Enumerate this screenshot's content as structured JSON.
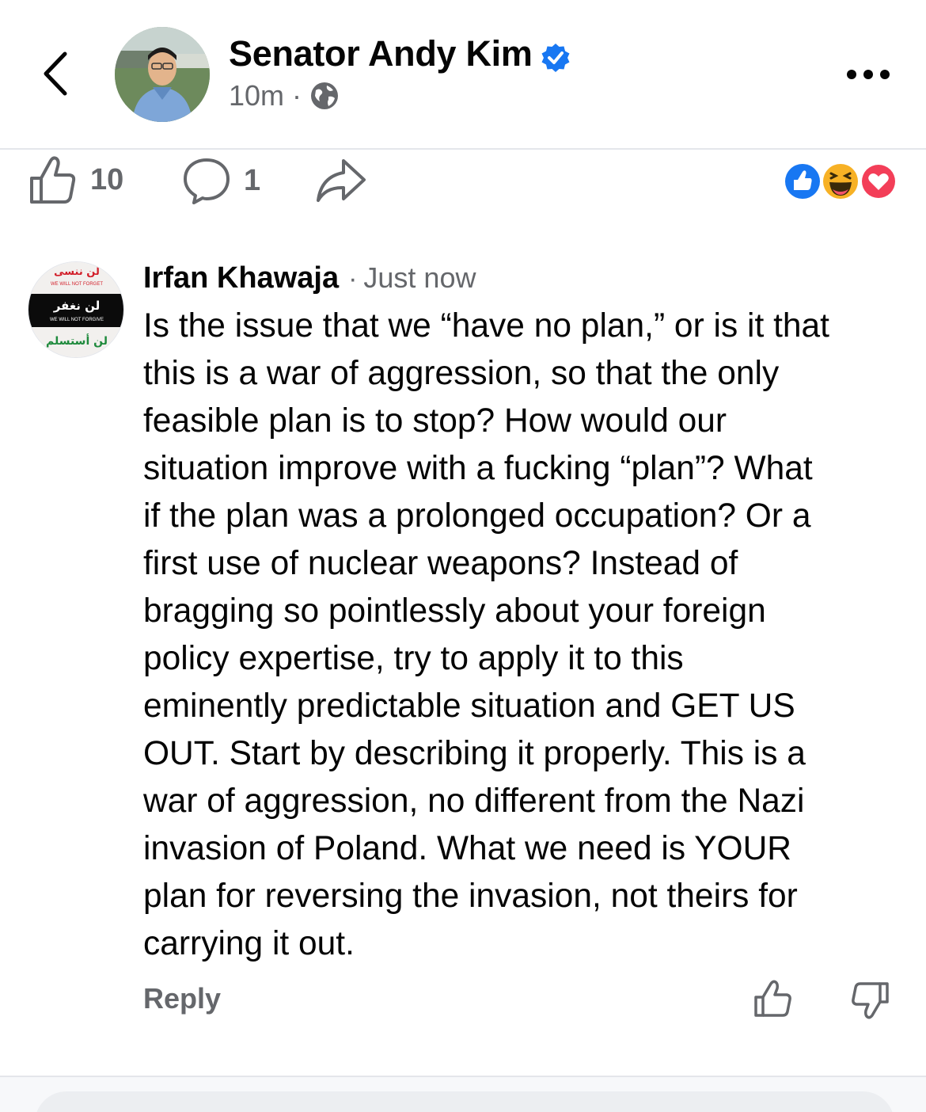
{
  "post": {
    "author": "Senator Andy Kim",
    "time": "10m",
    "separator": "·",
    "likes": "10",
    "comments": "1"
  },
  "comment": {
    "author": "Irfan Khawaja",
    "separator": "·",
    "time": "Just now",
    "lines": [
      "Is the issue that we “have no plan,” or is it that",
      "this is a war of aggression, so that the only",
      "feasible plan is to stop? How would our",
      "situation improve with a fucking “plan”? What",
      "if the plan was a prolonged occupation? Or a",
      "first use of nuclear weapons? Instead of",
      "bragging so pointlessly about your foreign",
      "policy expertise, try to apply it to this",
      "eminently predictable situation and GET US",
      "OUT. Start by describing it properly. This is a",
      "war of aggression, no different from the Nazi",
      "invasion of Poland. What we need is YOUR",
      "plan for reversing the invasion, not theirs for",
      "carrying it out."
    ],
    "reply_label": "Reply",
    "avatar_text": {
      "top": "WE WILL NOT FORGET",
      "arabic_middle": "لن نغفر",
      "middle": "WE WILL NOT FORGIVE",
      "arabic_top": "لن ننسى",
      "arabic_bottom": "لن أستسلم"
    }
  },
  "icons": {
    "back": "chevron-left-icon",
    "verified": "verified-badge-icon",
    "audience": "globe-icon",
    "more": "more-horizontal-icon",
    "like": "thumbs-up-icon",
    "comment": "comment-bubble-icon",
    "share": "share-arrow-icon",
    "reactions": [
      "like-reaction-icon",
      "haha-reaction-icon",
      "love-reaction-icon"
    ],
    "vote_up": "thumbs-up-icon",
    "vote_down": "thumbs-down-icon"
  },
  "colors": {
    "brand_blue": "#1877f2",
    "text_primary": "#050505",
    "text_secondary": "#65676b",
    "love_red": "#f33e58",
    "haha_yellow": "#f7b125"
  }
}
